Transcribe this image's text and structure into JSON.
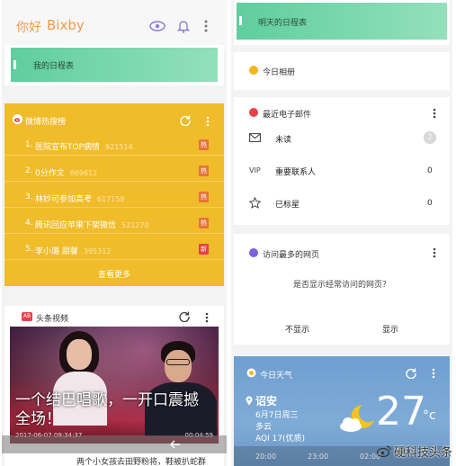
{
  "left": {
    "header": {
      "greeting": "你好",
      "brand": "Bixby"
    },
    "schedule": {
      "title": "我的日程表"
    },
    "weibo": {
      "title": "微博热搜榜",
      "more": "查看更多",
      "items": [
        {
          "rank": "1.",
          "text": "医院宣布TOP病情",
          "count": "921514",
          "badge": "热"
        },
        {
          "rank": "2.",
          "text": "0分作文",
          "count": "869612",
          "badge": "热"
        },
        {
          "rank": "3.",
          "text": "林妙可参加高考",
          "count": "617158",
          "badge": "热"
        },
        {
          "rank": "4.",
          "text": "腾讯回应苹果下架微信",
          "count": "521270",
          "badge": "热"
        },
        {
          "rank": "5.",
          "text": "李小璐 甜馨",
          "count": "395312",
          "badge": "新"
        }
      ]
    },
    "video": {
      "title": "头条视频",
      "caption": "一个结巴唱歌，一开口震撼全场！",
      "date": "2017-06-07 09:34:37",
      "duration": "00:04:59",
      "next": "两个小女孩去田野粉将，鞋被扒蛇群"
    }
  },
  "right": {
    "schedule": {
      "title": "明天的日程表"
    },
    "album": {
      "title": "今日相册"
    },
    "email": {
      "title": "最近电子邮件",
      "rows": [
        {
          "icon": "envelope-icon",
          "label": "未读",
          "count": "2"
        },
        {
          "icon": "vip-icon",
          "icon_text": "VIP",
          "label": "重要联系人",
          "count": "0"
        },
        {
          "icon": "star-icon",
          "label": "已标星",
          "count": "0"
        }
      ]
    },
    "web": {
      "title": "访问最多的网页",
      "question": "是否显示经常访问的网页？",
      "deny": "不显示",
      "allow": "显示"
    },
    "weather": {
      "title": "今日天气",
      "city": "诏安",
      "date": "6月7日周三",
      "condition": "多云",
      "aqi": "AQI 17(优质)",
      "temp": "27",
      "unit": "°c",
      "hours": [
        "20:00",
        "23:00",
        "02:00"
      ]
    },
    "watermark": "硬科技头条"
  },
  "colors": {
    "accent_orange": "#f39a4c",
    "teal": "#5fce9e",
    "weibo_yellow": "#f0bc2a",
    "hot_badge": "#e5743c",
    "new_badge": "#e8404a"
  }
}
